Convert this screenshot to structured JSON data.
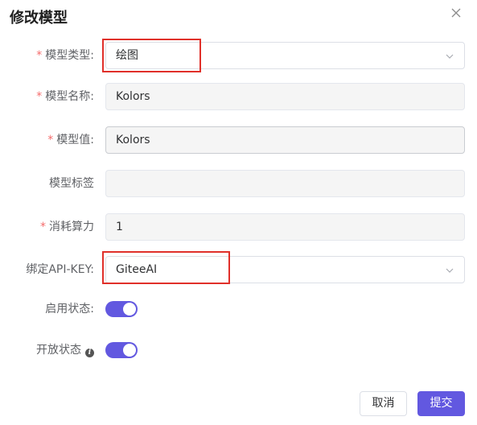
{
  "dialog": {
    "title": "修改模型",
    "close_icon": "close-icon"
  },
  "form": {
    "model_type": {
      "label": "模型类型:",
      "required": "*",
      "value": "绘图",
      "icon": "chevron-down-icon"
    },
    "model_name": {
      "label": "模型名称:",
      "required": "*",
      "value": "Kolors"
    },
    "model_value": {
      "label": "模型值:",
      "required": "*",
      "value": "Kolors"
    },
    "model_tag": {
      "label": "模型标签",
      "value": ""
    },
    "power_cost": {
      "label": "消耗算力",
      "required": "*",
      "value": "1"
    },
    "api_key": {
      "label": "绑定API-KEY:",
      "value": "GiteeAI",
      "icon": "chevron-down-icon"
    },
    "enabled": {
      "label": "启用状态:",
      "on": true
    },
    "open": {
      "label": "开放状态",
      "info_icon": "info-icon",
      "on": true
    }
  },
  "footer": {
    "cancel_label": "取消",
    "submit_label": "提交"
  },
  "colors": {
    "accent": "#6258e0",
    "required": "#f56c6c",
    "highlight_box": "#e0302a"
  }
}
